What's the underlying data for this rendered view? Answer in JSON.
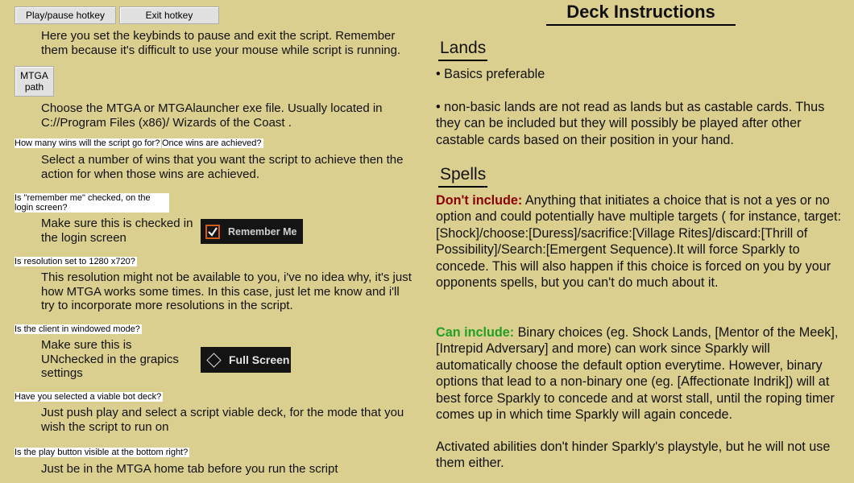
{
  "left": {
    "hotkey_buttons": {
      "pause": "Play/pause hotkey",
      "exit": "Exit hotkey"
    },
    "hotkey_desc": "Here you set the keybinds to pause and exit the script. Remember them because it's difficult to use your mouse while script is running.",
    "mtga_path_button": {
      "line1": "MTGA",
      "line2": "path"
    },
    "mtga_path_desc": "Choose the MTGA or MTGAlauncher exe file. Usually located in C://Program Files (x86)/ Wizards of the Coast .",
    "wins_question": "How many wins will the script go for?",
    "wins_achieved_question": "Once wins are achieved?",
    "wins_desc": "Select a number of wins that you want the script to achieve then the action for when those wins are achieved.",
    "remember_question": "Is \"remember me\" checked, on the login screen?",
    "remember_desc": "Make sure this is checked in the login screen",
    "remember_widget_label": "Remember Me",
    "resolution_question": "Is resolution set to 1280 x720?",
    "resolution_desc": "This resolution might not be available to you, i've no idea why, it's just how MTGA works some times. In this case, just let me know and i'll try to incorporate more resolutions in the script.",
    "windowed_question": "Is the client in windowed mode?",
    "windowed_desc": "Make sure this is UNchecked in the grapics settings",
    "fullscreen_widget_label": "Full Screen",
    "deck_question": "Have you selected a viable bot deck?",
    "deck_desc": "Just push play and select a script viable deck, for the mode that you wish the script to run on",
    "play_question": "Is the play button visible at the bottom right?",
    "play_desc": "Just be in the MTGA home tab before you run the script"
  },
  "right": {
    "title": "Deck Instructions",
    "lands_heading": "Lands",
    "lands_bullet1": "• Basics preferable",
    "lands_bullet2": "• non-basic lands are not read as lands but as castable cards. Thus they can be included but they will possibly be played after other castable cards based on their position in your hand.",
    "spells_heading": "Spells",
    "dont_label": "Don't include:",
    "dont_text": " Anything that initiates a choice that is not a yes or no option and could potentially have multiple targets ( for instance, target:[Shock]/choose:[Duress]/sacrifice:[Village Rites]/discard:[Thrill of Possibility]/Search:[Emergent Sequence).It will force Sparkly to concede. This will also happen if this choice is forced on you by your opponents spells, but you can't do much about it.",
    "can_label": "Can include:",
    "can_text": " Binary choices (eg. Shock Lands, [Mentor of the Meek], [Intrepid Adversary] and more) can work since Sparkly will automatically choose the default option everytime. However, binary options that lead to a non-binary one (eg. [Affectionate Indrik]) will at best force Sparkly to concede and at worst stall, until the roping timer comes up in which time Sparkly will again concede.",
    "activated_text": "Activated abilities don't hinder Sparkly's playstyle, but he will not use them either."
  },
  "colors": {
    "background": "#dbcf90",
    "dont_include": "#8b0000",
    "can_include": "#22a022"
  }
}
